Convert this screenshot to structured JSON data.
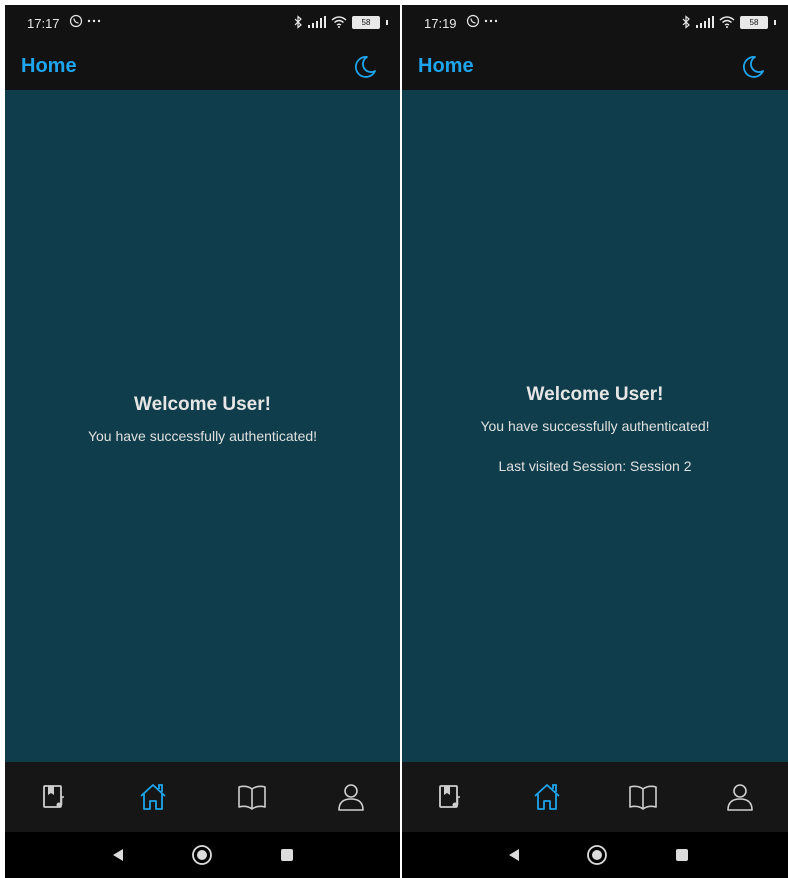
{
  "colors": {
    "accent": "#1ea5ec",
    "content_bg": "#0f3d4b",
    "bar_bg": "#121212",
    "icon_inactive": "#cfcfcf"
  },
  "screens": [
    {
      "status": {
        "time": "17:17",
        "battery": "58"
      },
      "header": {
        "title": "Home"
      },
      "welcome_title": "Welcome User!",
      "welcome_subtitle": "You have successfully authenticated!",
      "nav": [
        "music-book-icon",
        "home-icon",
        "book-icon",
        "user-icon"
      ],
      "active_nav": "home-icon"
    },
    {
      "status": {
        "time": "17:19",
        "battery": "58"
      },
      "header": {
        "title": "Home"
      },
      "welcome_title": "Welcome User!",
      "welcome_subtitle": "You have successfully authenticated!",
      "last_visited": "Last visited Session: Session 2",
      "nav": [
        "music-book-icon",
        "home-icon",
        "book-icon",
        "user-icon"
      ],
      "active_nav": "home-icon"
    }
  ]
}
